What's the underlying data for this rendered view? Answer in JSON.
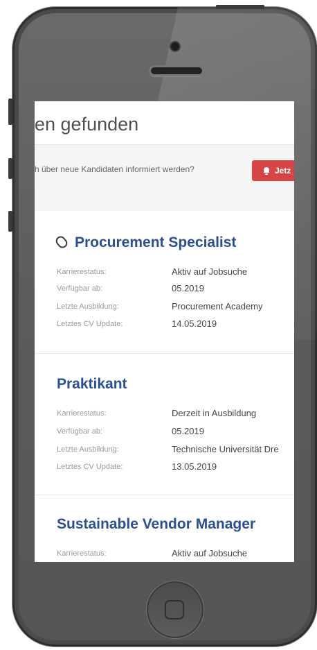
{
  "header": {
    "results_title": "en gefunden"
  },
  "notify": {
    "question": "h über neue Kandidaten informiert werden?",
    "button_label": "Jetz"
  },
  "labels": {
    "career_status": "Karrierestatus:",
    "available_from": "Verfügbar ab:",
    "last_education": "Letzte Ausbildung:",
    "last_cv_update": "Letztes CV Update:"
  },
  "candidates": [
    {
      "title": "Procurement Specialist",
      "career_status": "Aktiv auf Jobsuche",
      "available_from": "05.2019",
      "last_education": "Procurement Academy",
      "last_cv_update": "14.05.2019",
      "icon": "paperclip-icon"
    },
    {
      "title": "Praktikant",
      "career_status": "Derzeit in Ausbildung",
      "available_from": "05.2019",
      "last_education": "Technische Universität Dre",
      "last_cv_update": "13.05.2019"
    },
    {
      "title": "Sustainable Vendor Manager",
      "career_status": "Aktiv auf Jobsuche"
    }
  ],
  "colors": {
    "accent_button": "#d64545",
    "title_blue": "#2b4f8f",
    "phone_body": "#5f5f5f"
  }
}
